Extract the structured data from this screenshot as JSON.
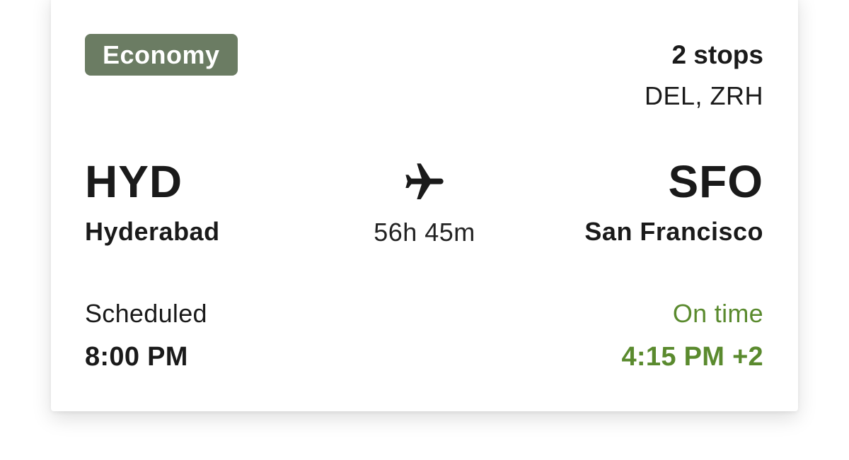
{
  "flight": {
    "cabin_class": "Economy",
    "stops_count": "2 stops",
    "stops_airports": "DEL, ZRH",
    "origin": {
      "code": "HYD",
      "city": "Hyderabad"
    },
    "destination": {
      "code": "SFO",
      "city": "San Francisco"
    },
    "duration": "56h 45m",
    "departure": {
      "status": "Scheduled",
      "time": "8:00 PM"
    },
    "arrival": {
      "status": "On time",
      "time": "4:15 PM +2"
    }
  },
  "icons": {
    "plane": "airplane-icon"
  },
  "colors": {
    "badge_background": "#6b7c63",
    "on_time_green": "#5a8a2e",
    "text": "#1a1a1a"
  }
}
